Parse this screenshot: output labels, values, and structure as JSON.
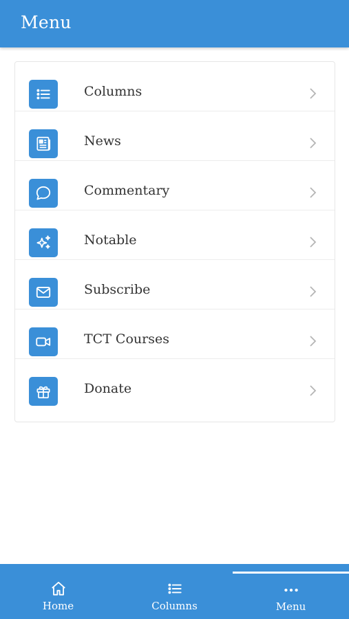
{
  "header": {
    "title": "Menu"
  },
  "menu": {
    "items": [
      {
        "label": "Columns",
        "icon": "list-icon"
      },
      {
        "label": "News",
        "icon": "newspaper-icon"
      },
      {
        "label": "Commentary",
        "icon": "chat-bubble-icon"
      },
      {
        "label": "Notable",
        "icon": "sparkles-icon"
      },
      {
        "label": "Subscribe",
        "icon": "envelope-icon"
      },
      {
        "label": "TCT Courses",
        "icon": "video-camera-icon"
      },
      {
        "label": "Donate",
        "icon": "gift-icon"
      }
    ]
  },
  "bottom_nav": {
    "tabs": [
      {
        "label": "Home",
        "icon": "home-icon"
      },
      {
        "label": "Columns",
        "icon": "list-icon"
      },
      {
        "label": "Menu",
        "icon": "more-dots-icon",
        "active": true
      }
    ]
  },
  "colors": {
    "accent": "#3a8fd8",
    "text": "#333333",
    "chevron": "#b5b5b5"
  }
}
